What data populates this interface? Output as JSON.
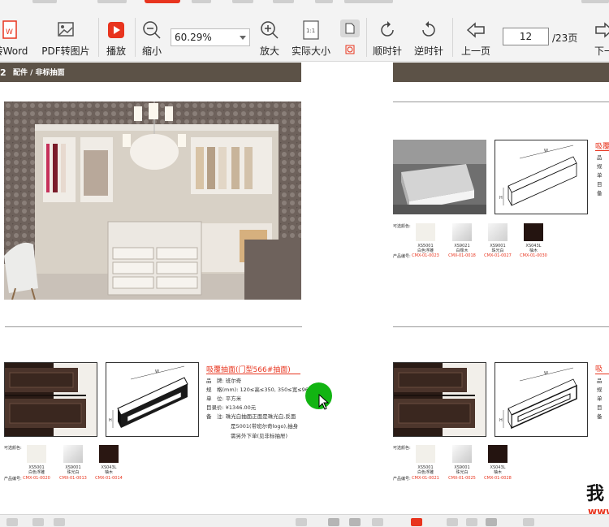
{
  "toolbar": {
    "to_word_label": "转Word",
    "pdf_to_image_label": "PDF转图片",
    "play_label": "播放",
    "zoom_out_label": "缩小",
    "zoom_value": "60.29%",
    "zoom_in_label": "放大",
    "actual_size_label": "实际大小",
    "clockwise_label": "顺时针",
    "counterclockwise_label": "逆时针",
    "prev_page_label": "上一页",
    "next_page_label": "下一",
    "current_page": "12",
    "total_pages": "/23页"
  },
  "left_page": {
    "page_num": "2",
    "header": "配件 / 非标抽面",
    "product_title": "吸覆抽面(门型566#抽面)",
    "specs": [
      {
        "key": "品　牌:",
        "value": "班尔奇"
      },
      {
        "key": "规　格(mm):",
        "value": "120≤高≤350, 350≤宽≤960"
      },
      {
        "key": "单　位:",
        "value": "平方米"
      },
      {
        "key": "目录价:",
        "value": "¥1346.00元"
      },
      {
        "key": "备　注:",
        "value": "珠光白抽面正面是珠光白,反面"
      },
      {
        "key": "",
        "value": "是5001(带班尔奇logo),抽身"
      },
      {
        "key": "",
        "value": "需另外下单(见非标抽屉)"
      }
    ],
    "colors_label": "可选颜色:",
    "code_label": "产品编号:",
    "swatches": [
      {
        "name1": "XS5001",
        "name2": "白色浮雕",
        "code": "CMX-01-0020",
        "color": "#f2f0ea"
      },
      {
        "name1": "XS9001",
        "name2": "珠光白",
        "code": "CMX-01-0013",
        "color": "#d9d9d9"
      },
      {
        "name1": "XS043L",
        "name2": "柚木",
        "code": "CMX-01-0014",
        "color": "#2a1712"
      }
    ]
  },
  "right_page": {
    "title_partial_top": "吸覆",
    "title_partial_bottom": "吸",
    "labels_top": [
      "品",
      "规",
      "单",
      "目",
      "备"
    ],
    "labels_bottom": [
      "品",
      "规",
      "单",
      "目",
      "备"
    ],
    "colors_label": "可选颜色:",
    "code_label": "产品编号:",
    "swatches_top": [
      {
        "name1": "XS5001",
        "name2": "白色浮雕",
        "code": "CMX-01-0023",
        "color": "#f2f0ea"
      },
      {
        "name1": "XS9021",
        "name2": "白橡木",
        "code": "CMX-01-0018",
        "color": "#dadada"
      },
      {
        "name1": "XS9001",
        "name2": "珠光白",
        "code": "CMX-01-0027",
        "color": "#e2e2e2"
      },
      {
        "name1": "XS043L",
        "name2": "柚木",
        "code": "CMX-01-0030",
        "color": "#241410"
      }
    ],
    "swatches_bottom": [
      {
        "name1": "XS5001",
        "name2": "白色浮雕",
        "code": "CMX-01-0021",
        "color": "#f2f0ea"
      },
      {
        "name1": "XS9001",
        "name2": "珠光白",
        "code": "CMX-01-0025",
        "color": "#dadada"
      },
      {
        "name1": "XS043L",
        "name2": "柚木",
        "code": "CMX-01-0028",
        "color": "#241410"
      }
    ]
  },
  "watermark": {
    "main": "我",
    "sub": "www"
  },
  "colors": {
    "accent": "#e8341e",
    "header_band": "#5c5247",
    "dark_wood": "#2a1712"
  }
}
